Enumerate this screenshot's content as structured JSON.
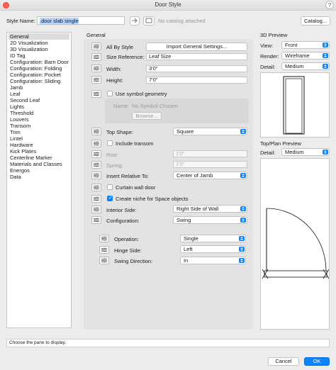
{
  "window": {
    "title": "Door Style"
  },
  "header": {
    "style_name_label": "Style Name:",
    "style_name_value": ".door slab single",
    "catalog_status": "No catalog attached",
    "catalog_button": "Catalog..."
  },
  "panes": {
    "items": [
      "General",
      "2D Visualization",
      "3D Visualization",
      "ID Tag",
      "Configuration: Barn Door",
      "Configuration: Folding",
      "Configuration: Pocket",
      "Configuration: Sliding",
      "Jamb",
      "Leaf",
      "Second Leaf",
      "Lights",
      "Threshold",
      "Louvers",
      "Transom",
      "Trim",
      "Lintel",
      "Hardware",
      "Kick Plates",
      "Centerline Marker",
      "Materials and Classes",
      "Energos",
      "Data"
    ],
    "selected": "General"
  },
  "general": {
    "section_label": "General",
    "all_by_style_label": "All By Style",
    "import_button": "Import General Settings...",
    "size_reference_label": "Size Reference:",
    "size_reference_value": "Leaf Size",
    "width_label": "Width:",
    "width_value": "3'0\"",
    "height_label": "Height:",
    "height_value": "7'0\"",
    "use_symbol_label": "Use symbol geometry",
    "symbol_name_label": "Name:",
    "symbol_name_value": "No Symbol Chosen",
    "browse_button": "Browse...",
    "top_shape_label": "Top Shape:",
    "top_shape_value": "Square",
    "include_transom_label": "Include transom",
    "rise_label": "Rise:",
    "rise_value": "1'0\"",
    "spring_label": "Spring:",
    "spring_value": "1'0\"",
    "insert_relative_label": "Insert Relative To:",
    "insert_relative_value": "Center of Jamb",
    "curtain_wall_label": "Curtain wall door",
    "create_niche_label": "Create niche for Space objects",
    "interior_side_label": "Interior Side:",
    "interior_side_value": "Right Side of Wall",
    "configuration_label": "Configuration:",
    "configuration_value": "Swing",
    "operation_label": "Operation:",
    "operation_value": "Single",
    "hinge_side_label": "Hinge Side:",
    "hinge_side_value": "Left",
    "swing_direction_label": "Swing Direction:",
    "swing_direction_value": "In"
  },
  "preview3d": {
    "title": "3D Preview",
    "view_label": "View:",
    "view_value": "Front",
    "render_label": "Render:",
    "render_value": "Wireframe",
    "detail_label": "Detail:",
    "detail_value": "Medium"
  },
  "preview2d": {
    "title": "Top/Plan Preview",
    "detail_label": "Detail:",
    "detail_value": "Medium"
  },
  "footer": {
    "status": "Choose the pane to display.",
    "cancel_button": "Cancel",
    "ok_button": "OK"
  },
  "colors": {
    "accent": "#0a84ff",
    "close": "#ff5f57"
  }
}
